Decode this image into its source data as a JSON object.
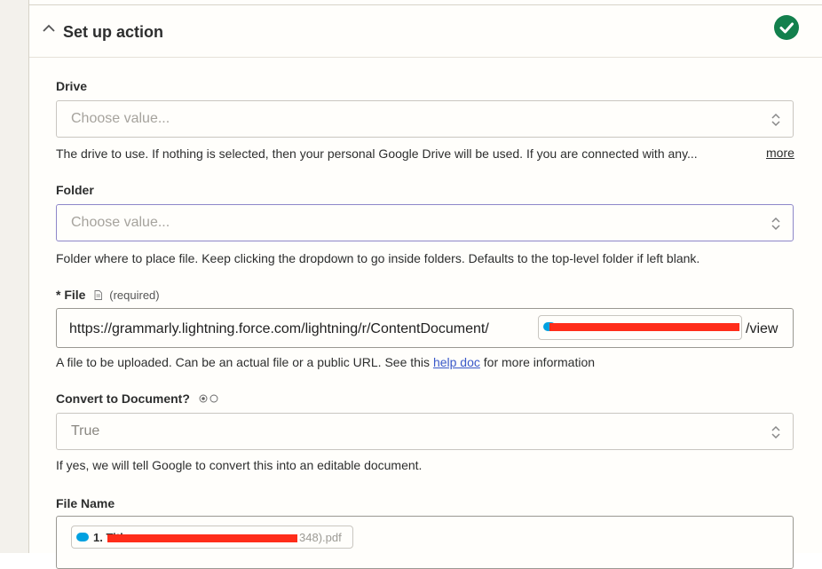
{
  "section": {
    "title": "Set up action"
  },
  "fields": {
    "drive": {
      "label": "Drive",
      "placeholder": "Choose value...",
      "help": "The drive to use. If nothing is selected, then your personal Google Drive will be used. If you are connected with any...",
      "more": "more"
    },
    "folder": {
      "label": "Folder",
      "placeholder": "Choose value...",
      "help": "Folder where to place file. Keep clicking the dropdown to go inside folders. Defaults to the top-level folder if left blank."
    },
    "file": {
      "label": "* File",
      "required": "(required)",
      "url_prefix": "https://grammarly.lightning.force.com/lightning/r/ContentDocument/",
      "url_suffix": "/view",
      "help_before": "A file to be uploaded. Can be an actual file or a public URL. See this ",
      "help_link": "help doc",
      "help_after": " for more information"
    },
    "convert": {
      "label": "Convert to Document?",
      "value": "True",
      "help": "If yes, we will tell Google to convert this into an editable document."
    },
    "file_name": {
      "label": "File Name",
      "pill_prefix": "1. Title",
      "pill_suffix": "348).pdf"
    }
  },
  "colors": {
    "success": "#13804d",
    "link": "#3a59c9",
    "salesforce": "#00a1e0",
    "redaction": "#ff2d1a"
  }
}
